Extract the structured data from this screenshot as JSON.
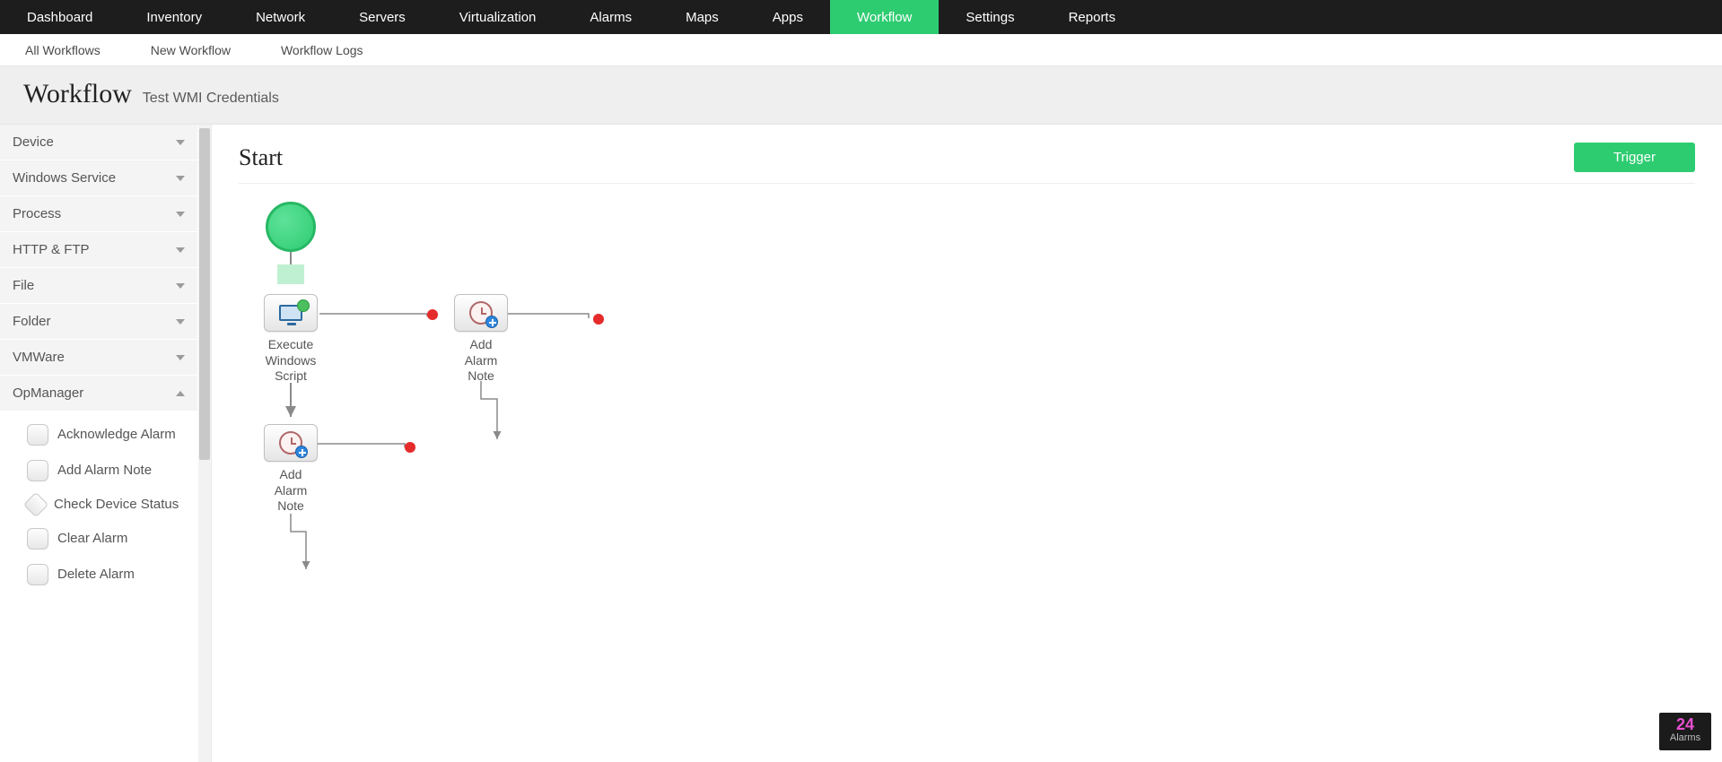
{
  "topnav": {
    "items": [
      {
        "label": "Dashboard"
      },
      {
        "label": "Inventory"
      },
      {
        "label": "Network"
      },
      {
        "label": "Servers"
      },
      {
        "label": "Virtualization"
      },
      {
        "label": "Alarms"
      },
      {
        "label": "Maps"
      },
      {
        "label": "Apps"
      },
      {
        "label": "Workflow",
        "active": true
      },
      {
        "label": "Settings"
      },
      {
        "label": "Reports"
      }
    ]
  },
  "subnav": {
    "items": [
      {
        "label": "All Workflows"
      },
      {
        "label": "New Workflow"
      },
      {
        "label": "Workflow Logs"
      }
    ]
  },
  "header": {
    "title": "Workflow",
    "subtitle": "Test WMI Credentials"
  },
  "sidebar": {
    "sections": [
      {
        "label": "Device",
        "expanded": false
      },
      {
        "label": "Windows Service",
        "expanded": false
      },
      {
        "label": "Process",
        "expanded": false
      },
      {
        "label": "HTTP & FTP",
        "expanded": false
      },
      {
        "label": "File",
        "expanded": false
      },
      {
        "label": "Folder",
        "expanded": false
      },
      {
        "label": "VMWare",
        "expanded": false
      },
      {
        "label": "OpManager",
        "expanded": true
      }
    ],
    "opmanager_actions": [
      {
        "label": "Acknowledge Alarm",
        "shape": "square"
      },
      {
        "label": "Add Alarm Note",
        "shape": "square"
      },
      {
        "label": "Check Device Status",
        "shape": "diamond"
      },
      {
        "label": "Clear Alarm",
        "shape": "square"
      },
      {
        "label": "Delete Alarm",
        "shape": "square"
      }
    ]
  },
  "canvas": {
    "title": "Start",
    "trigger_label": "Trigger",
    "nodes": {
      "exec": {
        "label": "Execute Windows Script"
      },
      "note1": {
        "label": "Add Alarm Note"
      },
      "note2": {
        "label": "Add Alarm Note"
      }
    }
  },
  "alarms_badge": {
    "count": "24",
    "label": "Alarms"
  }
}
